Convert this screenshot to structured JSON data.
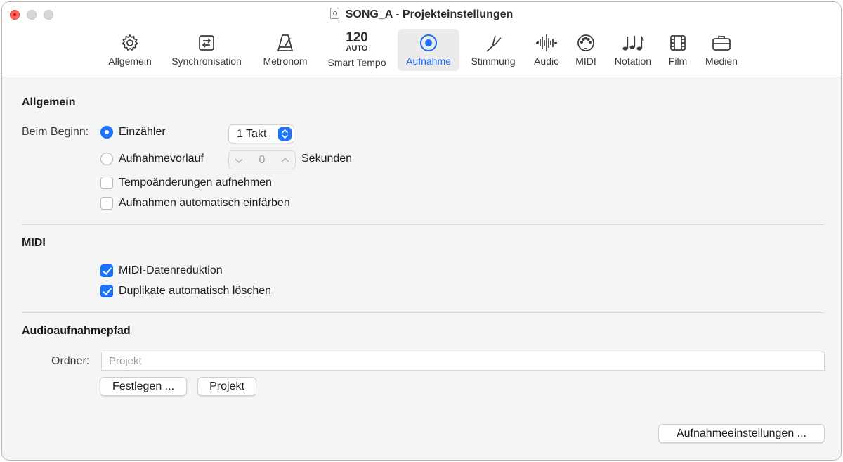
{
  "window": {
    "title": "SONG_A - Projekteinstellungen"
  },
  "tabs": [
    {
      "label": "Allgemein",
      "icon": "gear-icon"
    },
    {
      "label": "Synchronisation",
      "icon": "sync-icon"
    },
    {
      "label": "Metronom",
      "icon": "metronome-icon"
    },
    {
      "label": "Smart Tempo",
      "icon": "tempo-icon",
      "tempo_value": "120",
      "tempo_mode": "AUTO"
    },
    {
      "label": "Aufnahme",
      "icon": "record-icon",
      "active": true
    },
    {
      "label": "Stimmung",
      "icon": "tuning-fork-icon"
    },
    {
      "label": "Audio",
      "icon": "waveform-icon"
    },
    {
      "label": "MIDI",
      "icon": "midi-connector-icon"
    },
    {
      "label": "Notation",
      "icon": "notes-icon"
    },
    {
      "label": "Film",
      "icon": "film-icon"
    },
    {
      "label": "Medien",
      "icon": "briefcase-icon"
    }
  ],
  "general": {
    "heading": "Allgemein",
    "on_start_label": "Beim Beginn:",
    "count_in_label": "Einzähler",
    "count_in_value": "1 Takt",
    "preroll_label": "Aufnahmevorlauf",
    "preroll_value": "0",
    "seconds_label": "Sekunden",
    "tempo_changes_label": "Tempoänderungen aufnehmen",
    "auto_color_label": "Aufnahmen automatisch einfärben",
    "count_in_selected": true,
    "tempo_changes_checked": false,
    "auto_color_checked": false
  },
  "midi": {
    "heading": "MIDI",
    "data_reduction_label": "MIDI-Datenreduktion",
    "delete_duplicates_label": "Duplikate automatisch löschen",
    "data_reduction_checked": true,
    "delete_duplicates_checked": true
  },
  "audio_path": {
    "heading": "Audioaufnahmepfad",
    "folder_label": "Ordner:",
    "folder_placeholder": "Projekt",
    "set_button": "Festlegen ...",
    "project_button": "Projekt"
  },
  "footer": {
    "record_settings_button": "Aufnahmeeinstellungen ..."
  },
  "colors": {
    "accent": "#1a74ff",
    "close": "#ff5f57"
  }
}
